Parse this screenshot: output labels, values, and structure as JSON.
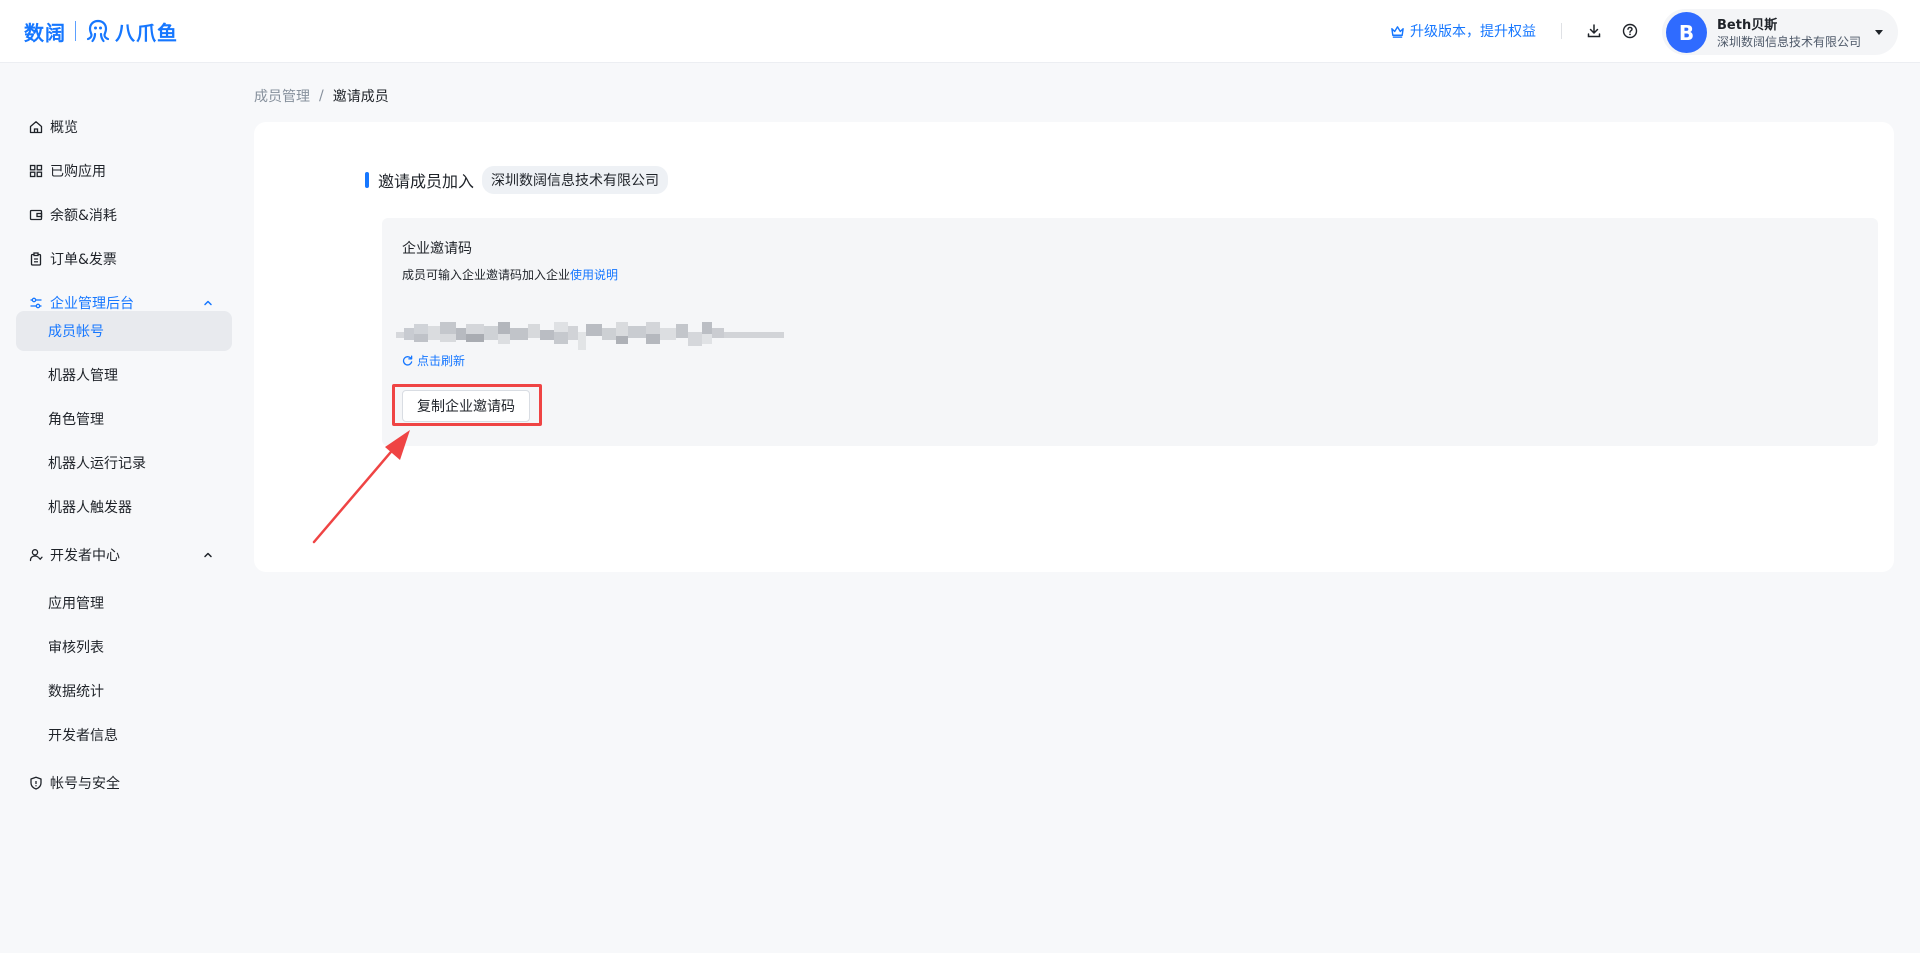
{
  "header": {
    "logo_primary": "数阔",
    "logo_secondary": "八爪鱼",
    "upgrade_label": "升级版本，提升权益",
    "download_icon": "download-icon",
    "help_icon": "help-icon",
    "user": {
      "avatar_letter": "B",
      "name": "Beth贝斯",
      "org": "深圳数阔信息技术有限公司"
    }
  },
  "sidebar": {
    "items": [
      {
        "label": "概览",
        "icon": "home-icon"
      },
      {
        "label": "已购应用",
        "icon": "apps-icon"
      },
      {
        "label": "余额&消耗",
        "icon": "wallet-icon"
      },
      {
        "label": "订单&发票",
        "icon": "clipboard-icon"
      },
      {
        "label": "企业管理后台",
        "icon": "sliders-icon",
        "expanded": true
      },
      {
        "label": "开发者中心",
        "icon": "person-icon",
        "expanded": true
      },
      {
        "label": "帐号与安全",
        "icon": "shield-icon"
      }
    ],
    "enterprise_sub": [
      "成员帐号",
      "机器人管理",
      "角色管理",
      "机器人运行记录",
      "机器人触发器"
    ],
    "developer_sub": [
      "应用管理",
      "审核列表",
      "数据统计",
      "开发者信息"
    ],
    "active_sub": "成员帐号"
  },
  "breadcrumb": {
    "parent": "成员管理",
    "separator": "/",
    "current": "邀请成员"
  },
  "main": {
    "section_title": "邀请成员加入",
    "org_tag": "深圳数阔信息技术有限公司",
    "code_label": "企业邀请码",
    "code_desc": "成员可输入企业邀请码加入企业",
    "code_desc_link": "使用说明",
    "refresh_label": "点击刷新",
    "copy_button": "复制企业邀请码"
  },
  "colors": {
    "accent": "#1677ff",
    "highlight": "#ef4444",
    "avatar": "#2f6bff"
  }
}
